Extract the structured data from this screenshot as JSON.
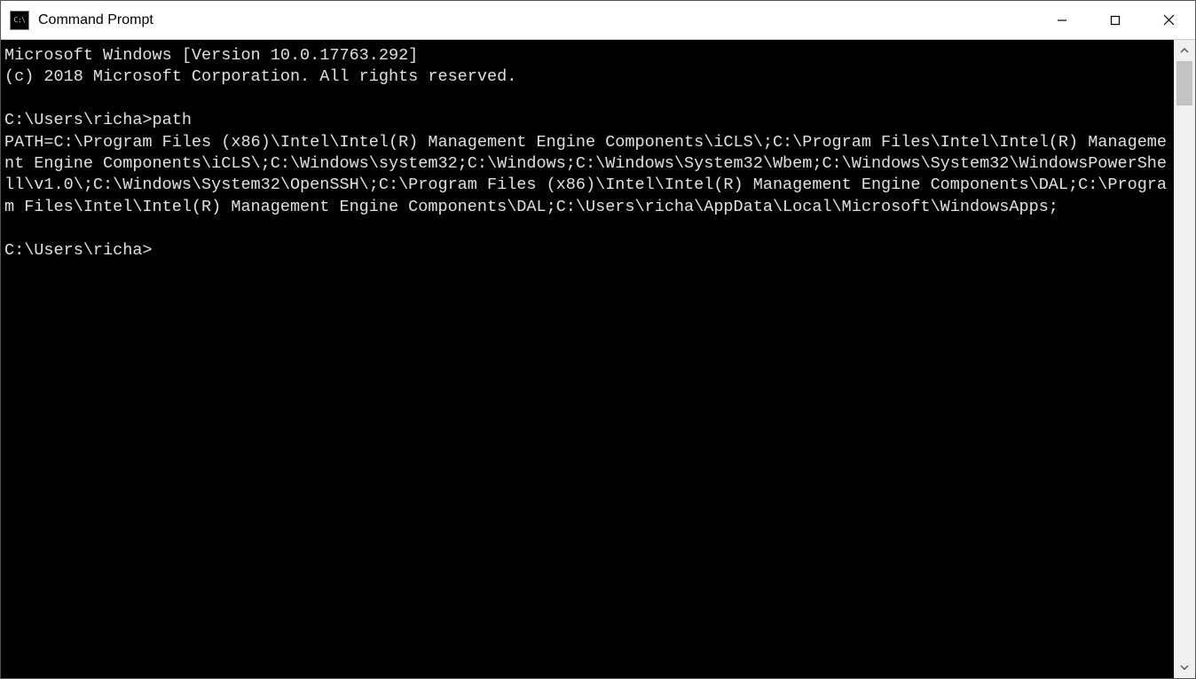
{
  "titlebar": {
    "icon_label": "C:\\",
    "title": "Command Prompt"
  },
  "terminal": {
    "banner_line1": "Microsoft Windows [Version 10.0.17763.292]",
    "banner_line2": "(c) 2018 Microsoft Corporation. All rights reserved.",
    "prompt1_prefix": "C:\\Users\\richa>",
    "prompt1_command": "path",
    "path_output": "PATH=C:\\Program Files (x86)\\Intel\\Intel(R) Management Engine Components\\iCLS\\;C:\\Program Files\\Intel\\Intel(R) Management Engine Components\\iCLS\\;C:\\Windows\\system32;C:\\Windows;C:\\Windows\\System32\\Wbem;C:\\Windows\\System32\\WindowsPowerShell\\v1.0\\;C:\\Windows\\System32\\OpenSSH\\;C:\\Program Files (x86)\\Intel\\Intel(R) Management Engine Components\\DAL;C:\\Program Files\\Intel\\Intel(R) Management Engine Components\\DAL;C:\\Users\\richa\\AppData\\Local\\Microsoft\\WindowsApps;",
    "prompt2_prefix": "C:\\Users\\richa>"
  }
}
